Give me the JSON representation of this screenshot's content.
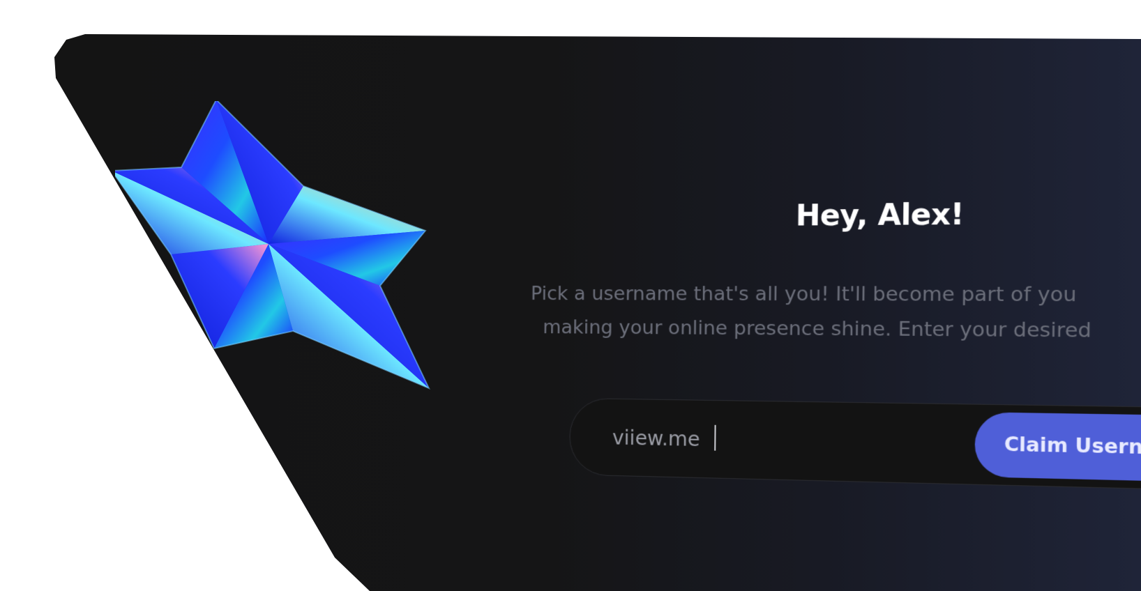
{
  "greeting": {
    "title": "Hey, Alex!"
  },
  "description": {
    "line1": "Pick a username that's all you! It'll become part of you",
    "line2": "making your online presence shine. Enter your desired"
  },
  "username_form": {
    "input_value": "viiew.me",
    "button_label": "Claim Usern"
  },
  "colors": {
    "card_background": "#151516",
    "card_gradient_end": "#1f2438",
    "accent_button": "#4f5fd8",
    "title_text": "#ffffff",
    "description_text": "#6b6e7a"
  },
  "icons": {
    "hero": "iridescent-star-icon"
  }
}
